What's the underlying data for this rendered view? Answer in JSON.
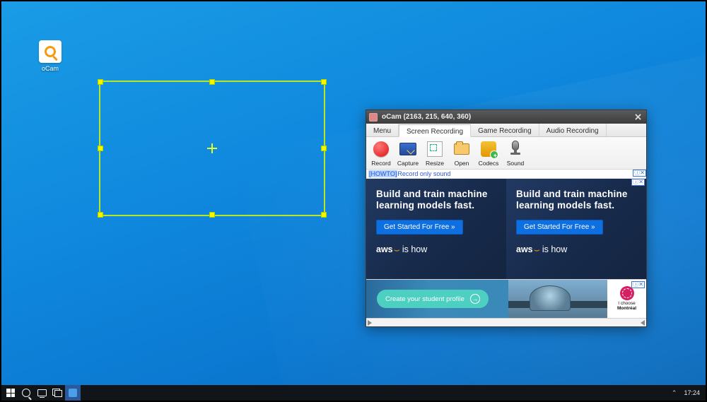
{
  "desktop_icon": {
    "label": "oCam"
  },
  "window": {
    "title": "oCam (2163, 215, 640, 360)",
    "tabs": [
      "Menu",
      "Screen Recording",
      "Game Recording",
      "Audio Recording"
    ],
    "active_tab": 1,
    "toolbar": [
      {
        "id": "record",
        "label": "Record"
      },
      {
        "id": "capture",
        "label": "Capture"
      },
      {
        "id": "resize",
        "label": "Resize"
      },
      {
        "id": "open",
        "label": "Open"
      },
      {
        "id": "codecs",
        "label": "Codecs"
      },
      {
        "id": "sound",
        "label": "Sound"
      }
    ],
    "howto_prefix": "[HOWTO]",
    "howto_text": "Record only sound",
    "ad_marker": "ⓘ✕",
    "aws_ad": {
      "headline": "Build and train machine learning models fast.",
      "cta": "Get Started For Free »",
      "brand": "aws",
      "tag": "is how"
    },
    "banner": {
      "cta": "Create your student profile",
      "right_line1": "I choose",
      "right_line2": "Montréal"
    }
  },
  "taskbar": {
    "clock": "17:24"
  }
}
